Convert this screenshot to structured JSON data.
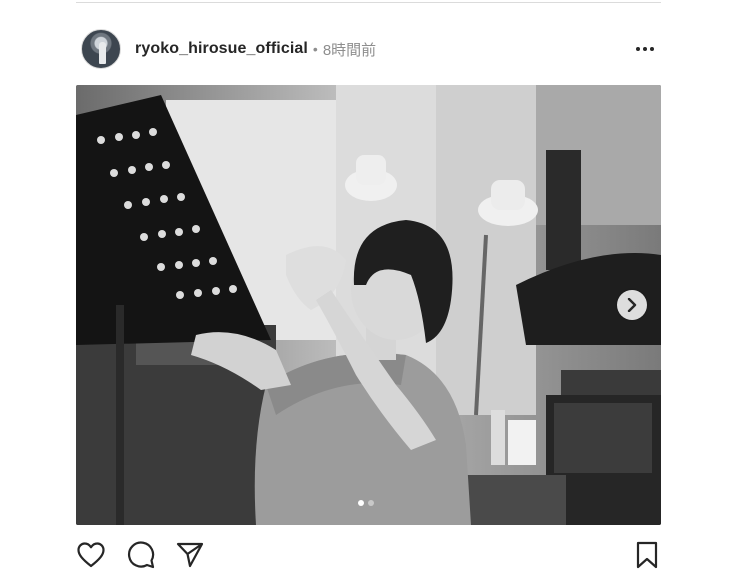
{
  "post": {
    "username": "ryoko_hirosue_official",
    "separator": "•",
    "timestamp": "8時間前"
  },
  "icons": {
    "more": "more-options-icon",
    "next": "chevron-right-icon",
    "like": "heart-icon",
    "comment": "comment-icon",
    "share": "paper-plane-icon",
    "save": "bookmark-icon"
  },
  "carousel": {
    "count": 2,
    "active_index": 0
  },
  "colors": {
    "text": "#262626",
    "muted": "#8e8e8e",
    "divider": "#dbdbdb"
  }
}
